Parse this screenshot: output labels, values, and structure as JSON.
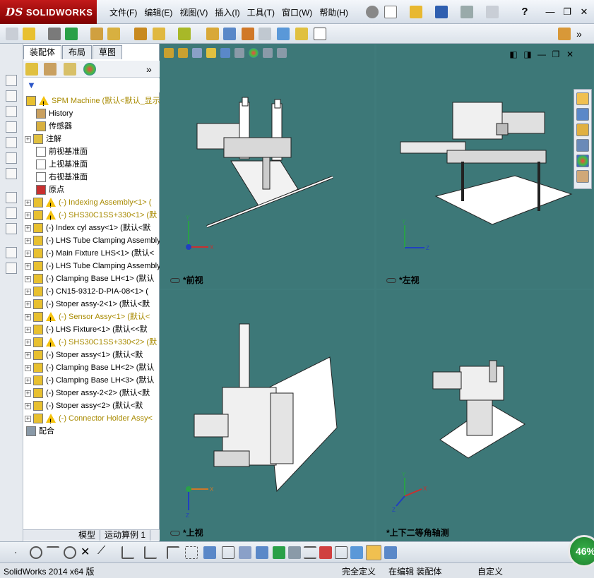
{
  "app": {
    "logo_text": "SOLIDWORKS",
    "logo_ds": "DS"
  },
  "menu": [
    "文件(F)",
    "编辑(E)",
    "视图(V)",
    "插入(I)",
    "工具(T)",
    "窗口(W)",
    "帮助(H)"
  ],
  "fm": {
    "tabs": [
      "装配体",
      "布局",
      "草图"
    ],
    "tree": [
      {
        "label": "SPM Machine  (默认<默认_显示",
        "warn": true,
        "plus": false,
        "icon": "assembly"
      },
      {
        "label": "History",
        "plus": false,
        "icon": "history",
        "indent": 1
      },
      {
        "label": "传感器",
        "plus": false,
        "icon": "sensor",
        "indent": 1
      },
      {
        "label": "注解",
        "plus": true,
        "icon": "annotation",
        "indent": 1
      },
      {
        "label": "前视基准面",
        "plus": false,
        "icon": "plane",
        "indent": 1
      },
      {
        "label": "上视基准面",
        "plus": false,
        "icon": "plane",
        "indent": 1
      },
      {
        "label": "右视基准面",
        "plus": false,
        "icon": "plane",
        "indent": 1
      },
      {
        "label": "原点",
        "plus": false,
        "icon": "origin",
        "indent": 1
      },
      {
        "label": "(-) Indexing  Assembly<1> (",
        "warn": true,
        "plus": true,
        "icon": "assembly"
      },
      {
        "label": "(-) SHS30C1SS+330<1> (默",
        "warn": true,
        "plus": true,
        "icon": "assembly"
      },
      {
        "label": "(-) Index cyl assy<1> (默认<默",
        "plus": true,
        "icon": "assembly"
      },
      {
        "label": "(-) LHS Tube Clamping Assembly",
        "plus": true,
        "icon": "assembly"
      },
      {
        "label": "(-) Main Fixture LHS<1> (默认<",
        "plus": true,
        "icon": "assembly"
      },
      {
        "label": "(-) LHS Tube Clamping Assembly",
        "plus": true,
        "icon": "assembly"
      },
      {
        "label": "(-) Clamping Base LH<1> (默认",
        "plus": true,
        "icon": "assembly"
      },
      {
        "label": "(-) CN15-9312-D-PIA-08<1> (",
        "plus": true,
        "icon": "assembly"
      },
      {
        "label": "(-) Stoper assy-2<1> (默认<默",
        "plus": true,
        "icon": "assembly"
      },
      {
        "label": "(-) Sensor Assy<1> (默认<",
        "warn": true,
        "plus": true,
        "icon": "assembly"
      },
      {
        "label": "(-) LHS Fixture<1> (默认<<默",
        "plus": true,
        "icon": "assembly"
      },
      {
        "label": "(-) SHS30C1SS+330<2> (默",
        "warn": true,
        "plus": true,
        "icon": "assembly"
      },
      {
        "label": "(-) Stoper assy<1> (默认<默",
        "plus": true,
        "icon": "assembly"
      },
      {
        "label": "(-) Clamping Base LH<2> (默认",
        "plus": true,
        "icon": "assembly"
      },
      {
        "label": "(-) Clamping Base LH<3> (默认",
        "plus": true,
        "icon": "assembly"
      },
      {
        "label": "(-) Stoper assy-2<2> (默认<默",
        "plus": true,
        "icon": "assembly"
      },
      {
        "label": "(-) Stoper assy<2> (默认<默",
        "plus": true,
        "icon": "assembly"
      },
      {
        "label": "(-) Connector Holder Assy<",
        "warn": true,
        "plus": true,
        "icon": "assembly"
      },
      {
        "label": "配合",
        "plus": false,
        "icon": "mates",
        "indent": 0
      }
    ],
    "bottom_tabs": [
      "模型",
      "运动算例 1"
    ]
  },
  "views": {
    "front": "*前视",
    "left": "*左视",
    "top": "*上视",
    "iso": "*上下二等角轴测"
  },
  "status": {
    "version": "SolidWorks 2014 x64 版",
    "defined": "完全定义",
    "editing": "在编辑 装配体",
    "custom": "自定义"
  },
  "progress": "46%",
  "colors": {
    "viewport_bg": "#3d7878",
    "warn_text": "#a88a00",
    "logo_red": "#c21a1a"
  }
}
